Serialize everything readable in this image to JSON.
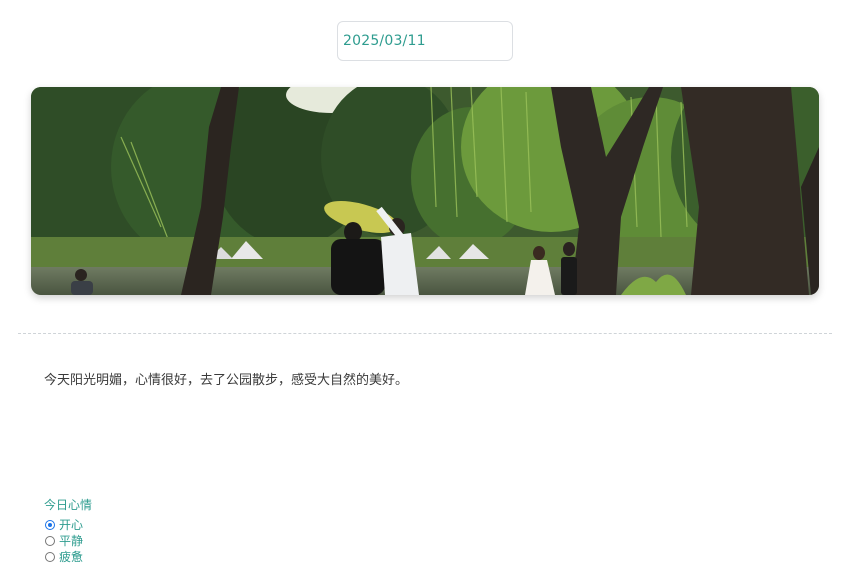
{
  "date_field": {
    "value": "2025/03/11"
  },
  "photo": {
    "subject": "park-lake-willows-wedding-photoshoot",
    "colors": {
      "sky": "#e9ecdf",
      "foliage_dark": "#2d4a26",
      "foliage_light": "#7fa845",
      "water": "#5b6a4e",
      "trunk": "#2b2520"
    }
  },
  "diary": {
    "text": "今天阳光明媚，心情很好，去了公园散步，感受大自然的美好。"
  },
  "mood": {
    "title": "今日心情",
    "options": [
      {
        "label": "开心",
        "checked": true
      },
      {
        "label": "平静",
        "checked": false
      },
      {
        "label": "疲惫",
        "checked": false
      }
    ]
  },
  "colors": {
    "accent": "#2e9c8f",
    "radio_checked": "#1a73e8",
    "divider": "#cfd4d8"
  }
}
